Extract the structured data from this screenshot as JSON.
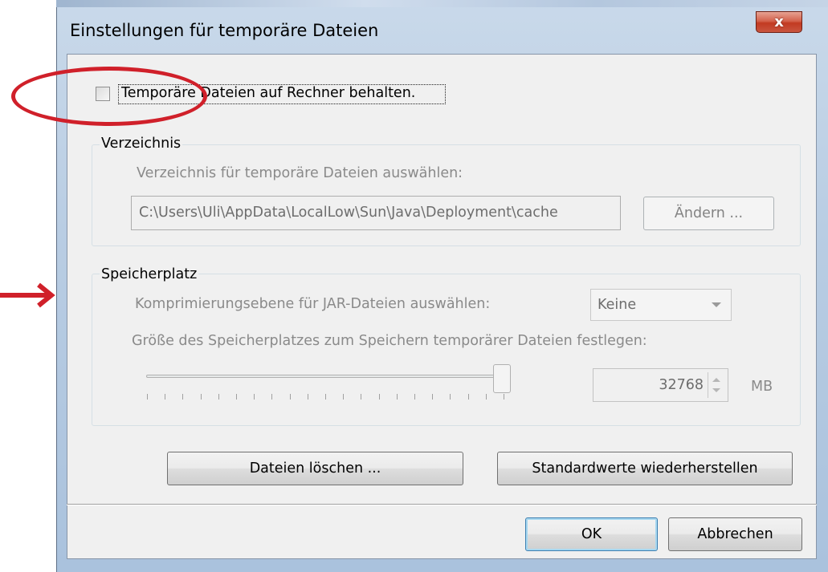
{
  "window": {
    "title": "Einstellungen für temporäre Dateien",
    "close_glyph": "x"
  },
  "keep_files": {
    "label": "Temporäre Dateien auf Rechner behalten.",
    "checked": false
  },
  "directory_group": {
    "title": "Verzeichnis",
    "prompt": "Verzeichnis für temporäre Dateien auswählen:",
    "path": "C:\\Users\\Uli\\AppData\\LocalLow\\Sun\\Java\\Deployment\\cache",
    "change_button": "Ändern ..."
  },
  "storage_group": {
    "title": "Speicherplatz",
    "compression_label": "Komprimierungsebene für JAR-Dateien auswählen:",
    "compression_value": "Keine",
    "size_label": "Größe des Speicherplatzes zum Speichern temporärer Dateien festlegen:",
    "size_value": "32768",
    "size_unit": "MB",
    "slider_fraction": 1.0
  },
  "actions": {
    "delete_files": "Dateien löschen ...",
    "restore_defaults": "Standardwerte wiederherstellen"
  },
  "footer": {
    "ok": "OK",
    "cancel": "Abbrechen"
  },
  "annotation_color": "#d0202a"
}
